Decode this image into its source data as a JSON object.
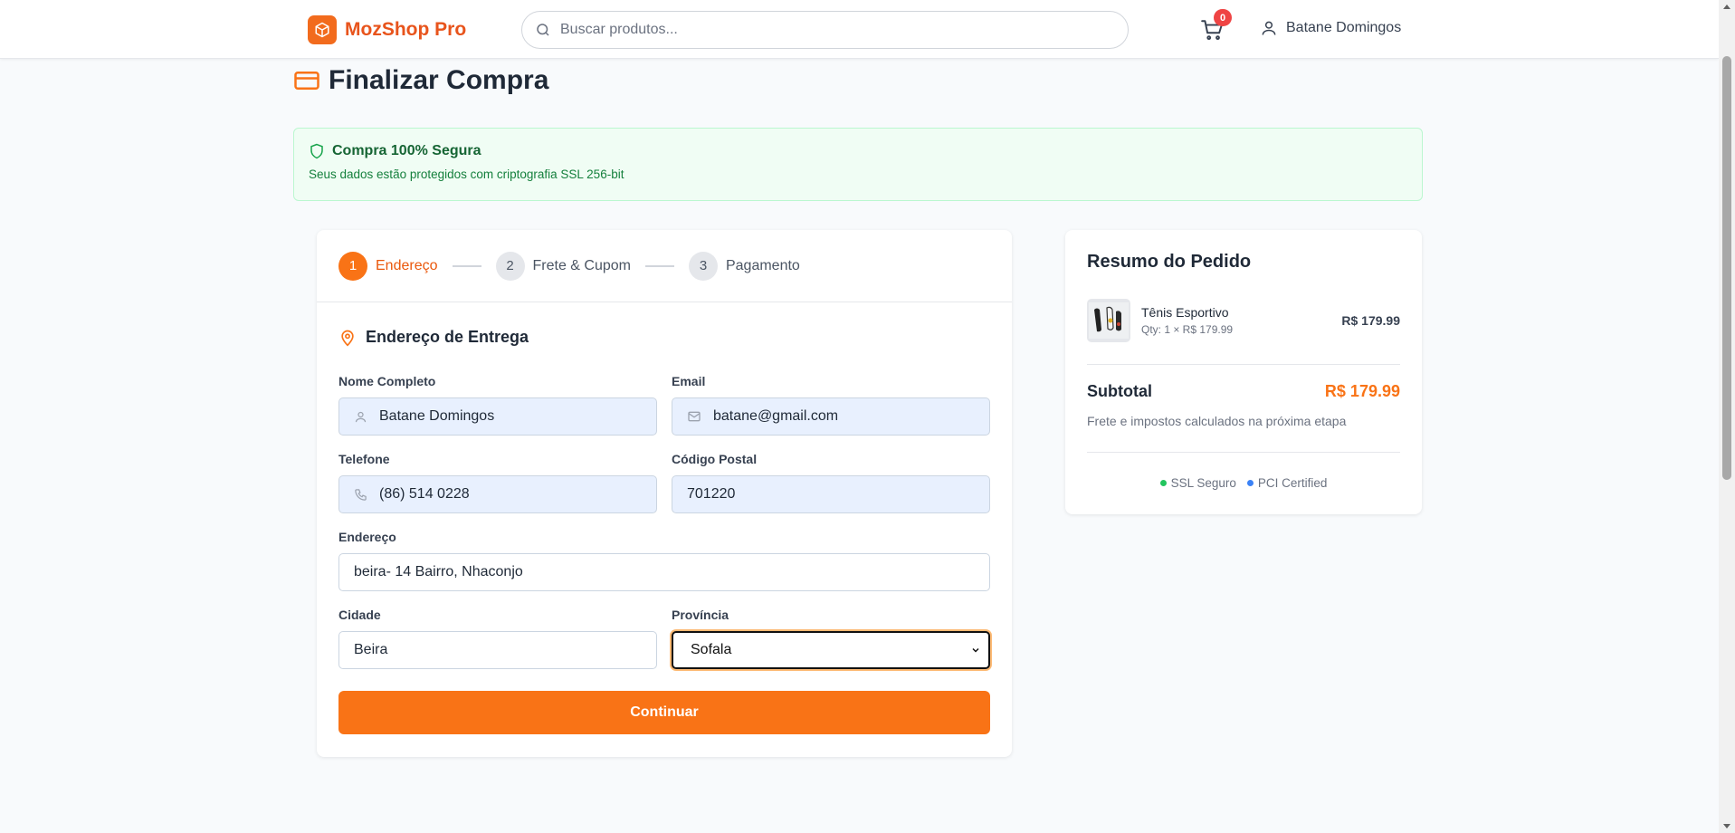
{
  "colors": {
    "brand": "#f97316",
    "success": "#22c55e",
    "info": "#3b82f6",
    "badge": "#ef4444"
  },
  "header": {
    "logo_icon": "box-icon",
    "logo_text": "MozShop Pro",
    "search_placeholder": "Buscar produtos...",
    "cart_count": "0",
    "user_name": "Batane Domingos"
  },
  "page": {
    "title": "Finalizar Compra"
  },
  "security": {
    "title": "Compra 100% Segura",
    "subtitle": "Seus dados estão protegidos com criptografia SSL 256-bit"
  },
  "steps": [
    {
      "num": "1",
      "label": "Endereço",
      "active": true
    },
    {
      "num": "2",
      "label": "Frete & Cupom",
      "active": false
    },
    {
      "num": "3",
      "label": "Pagamento",
      "active": false
    }
  ],
  "form": {
    "section_title": "Endereço de Entrega",
    "name_label": "Nome Completo",
    "name_value": "Batane Domingos",
    "email_label": "Email",
    "email_value": "batane@gmail.com",
    "phone_label": "Telefone",
    "phone_value": "(86) 514 0228",
    "postal_label": "Código Postal",
    "postal_value": "701220",
    "address_label": "Endereço",
    "address_value": "beira- 14 Bairro, Nhaconjo",
    "city_label": "Cidade",
    "city_value": "Beira",
    "province_label": "Província",
    "province_value": "Sofala",
    "continue_label": "Continuar"
  },
  "summary": {
    "title": "Resumo do Pedido",
    "item_name": "Tênis Esportivo",
    "item_qty": "Qty: 1 × R$ 179.99",
    "item_price": "R$ 179.99",
    "subtotal_label": "Subtotal",
    "subtotal_value": "R$ 179.99",
    "note": "Frete e impostos calculados na próxima etapa",
    "badge_ssl": "SSL Seguro",
    "badge_pci": "PCI Certified"
  }
}
